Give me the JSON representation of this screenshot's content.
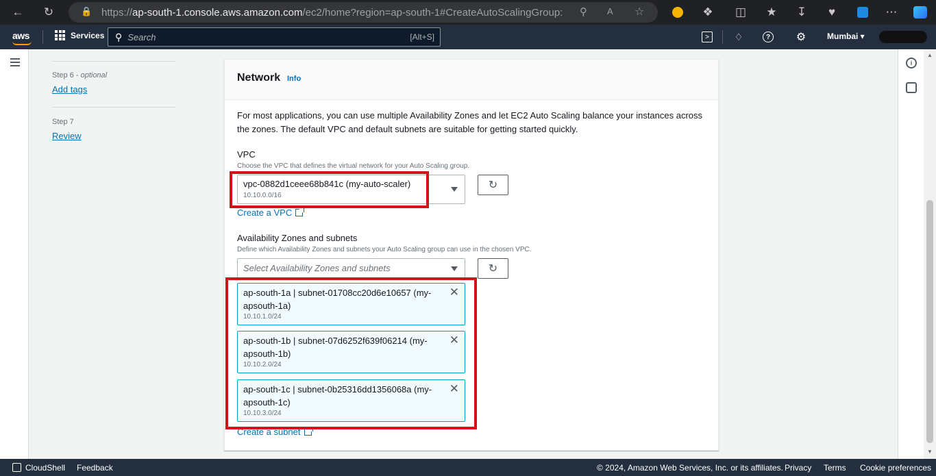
{
  "browser": {
    "url_prefix": "https://",
    "url_host": "ap-south-1.console.aws.amazon.com",
    "url_rest": "/ec2/home?region=ap-south-1#CreateAutoScalingGroup:"
  },
  "aws_nav": {
    "logo": "aws",
    "services_label": "Services",
    "search_placeholder": "Search",
    "search_shortcut": "[Alt+S]",
    "region": "Mumbai ▾"
  },
  "steps": [
    {
      "num": "Step 6 - ",
      "optional": "optional",
      "label": "Add tags"
    },
    {
      "num": "Step 7",
      "optional": "",
      "label": "Review"
    }
  ],
  "panel": {
    "title": "Network",
    "info": "Info",
    "description": "For most applications, you can use multiple Availability Zones and let EC2 Auto Scaling balance your instances across the zones. The default VPC and default subnets are suitable for getting started quickly.",
    "vpc": {
      "label": "VPC",
      "hint": "Choose the VPC that defines the virtual network for your Auto Scaling group.",
      "selected": "vpc-0882d1ceee68b841c (my-auto-scaler)",
      "cidr": "10.10.0.0/16",
      "create_link": "Create a VPC"
    },
    "az": {
      "label": "Availability Zones and subnets",
      "hint": "Define which Availability Zones and subnets your Auto Scaling group can use in the chosen VPC.",
      "placeholder": "Select Availability Zones and subnets",
      "subnets": [
        {
          "name": "ap-south-1a | subnet-01708cc20d6e10657 (my-apsouth-1a)",
          "cidr": "10.10.1.0/24"
        },
        {
          "name": "ap-south-1b | subnet-07d6252f639f06214 (my-apsouth-1b)",
          "cidr": "10.10.2.0/24"
        },
        {
          "name": "ap-south-1c | subnet-0b25316dd1356068a (my-apsouth-1c)",
          "cidr": "10.10.3.0/24"
        }
      ],
      "create_link": "Create a subnet"
    }
  },
  "footer": {
    "cloudshell": "CloudShell",
    "feedback": "Feedback",
    "copyright": "© 2024, Amazon Web Services, Inc. or its affiliates.",
    "privacy": "Privacy",
    "terms": "Terms",
    "cookies": "Cookie preferences"
  },
  "colors": {
    "highlight": "#d1141b",
    "link": "#0073bb",
    "nav_bg": "#232f3e",
    "token_bg": "#f1faff",
    "token_border": "#00a1c9"
  }
}
